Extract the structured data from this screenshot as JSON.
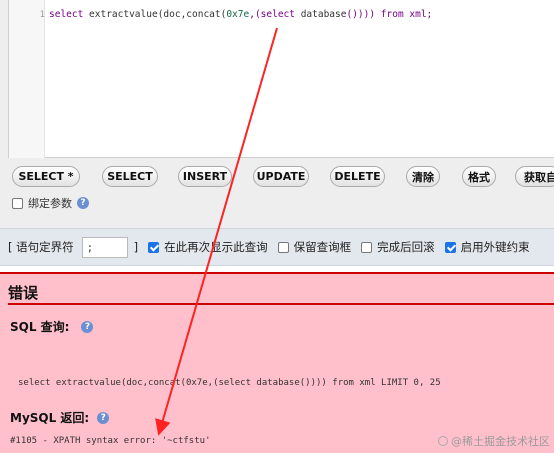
{
  "editor": {
    "line_number": "1",
    "code": {
      "p1": "select ",
      "p2": "extractvalue",
      "p3": "(doc,concat(",
      "p4": "0x7e",
      "p5": ",(select ",
      "p6": "database",
      "p7": "()))) from xml;"
    }
  },
  "buttons": [
    "SELECT *",
    "SELECT",
    "INSERT",
    "UPDATE",
    "DELETE",
    "清除",
    "格式",
    "获取自"
  ],
  "bind_params": {
    "label": "绑定参数",
    "checked": false
  },
  "separator": {
    "delim_label": "[ 语句定界符",
    "delim_value": ";",
    "delim_close": "]",
    "options": [
      {
        "label": "在此再次显示此查询",
        "checked": true
      },
      {
        "label": "保留查询框",
        "checked": false
      },
      {
        "label": "完成后回滚",
        "checked": false
      },
      {
        "label": "启用外键约束",
        "checked": true
      }
    ]
  },
  "error": {
    "title": "错误",
    "sql_heading": "SQL 查询:",
    "sql": "select extractvalue(doc,concat(0x7e,(select database()))) from xml LIMIT 0, 25",
    "mysql_heading": "MySQL 返回:",
    "message": "#1105 - XPATH syntax error: '~ctfstu'"
  },
  "watermark": "@稀土掘金技术社区",
  "colors": {
    "error_bg": "#ffc0cb",
    "error_border": "#cc0000",
    "arrow": "#ff2222",
    "checkbox": "#1a73e8"
  }
}
